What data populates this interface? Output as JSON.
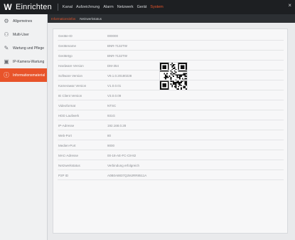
{
  "topbar": {
    "logo_icon": "brand-logo-icon",
    "logo_glyph": "W",
    "title": "Einrichten",
    "menu": [
      "Kanal",
      "Aufzeichnung",
      "Alarm",
      "Netzwerk",
      "Gerät",
      "System"
    ],
    "active_menu_index": 5,
    "close_glyph": "×",
    "accent_color": "#e8542a"
  },
  "sidebar": {
    "items": [
      {
        "label": "Allgemeines",
        "icon": "gear-icon",
        "glyph": "⚙"
      },
      {
        "label": "Multi-User",
        "icon": "user-icon",
        "glyph": "⚇"
      },
      {
        "label": "Wartung und Pflege",
        "icon": "wrench-icon",
        "glyph": "✎"
      },
      {
        "label": "IP-Kamera-Wartung",
        "icon": "camera-icon",
        "glyph": "▣"
      },
      {
        "label": "Informationsmaterial",
        "icon": "info-icon",
        "glyph": "ⓘ"
      }
    ],
    "active_index": 4
  },
  "tabs": [
    "Informationsinfos",
    "Netzwerkstatus"
  ],
  "active_tab_index": 0,
  "info_rows": [
    {
      "key": "Geräte-ID",
      "value": "000000"
    },
    {
      "key": "Gerätename",
      "value": "BNR-7132TW"
    },
    {
      "key": "Gerätetyp",
      "value": "BNR-7132TW"
    },
    {
      "key": "Hardware Version",
      "value": "DM-354"
    },
    {
      "key": "Software Version",
      "value": "V9.1.0.20180228"
    },
    {
      "key": "Kamerawar Version",
      "value": "V1.0.0.01"
    },
    {
      "key": "IE Client Version",
      "value": "V3.0.0.09"
    },
    {
      "key": "Videoformat",
      "value": "NTSC"
    },
    {
      "key": "HDD Laufwerk",
      "value": "931G"
    },
    {
      "key": "IP-Adresse",
      "value": "192.168.0.28"
    },
    {
      "key": "Web-Port",
      "value": "80"
    },
    {
      "key": "Medien-Port",
      "value": "9000"
    },
    {
      "key": "MAC-Adresse",
      "value": "00-18-AE-FC-C8-82"
    },
    {
      "key": "Netzwerkstatus",
      "value": "Verbindung erfolgreich"
    },
    {
      "key": "P2P ID",
      "value": "A0B0A8837Q2MJRR8511A"
    }
  ],
  "qr_icon": "qr-code-icon"
}
